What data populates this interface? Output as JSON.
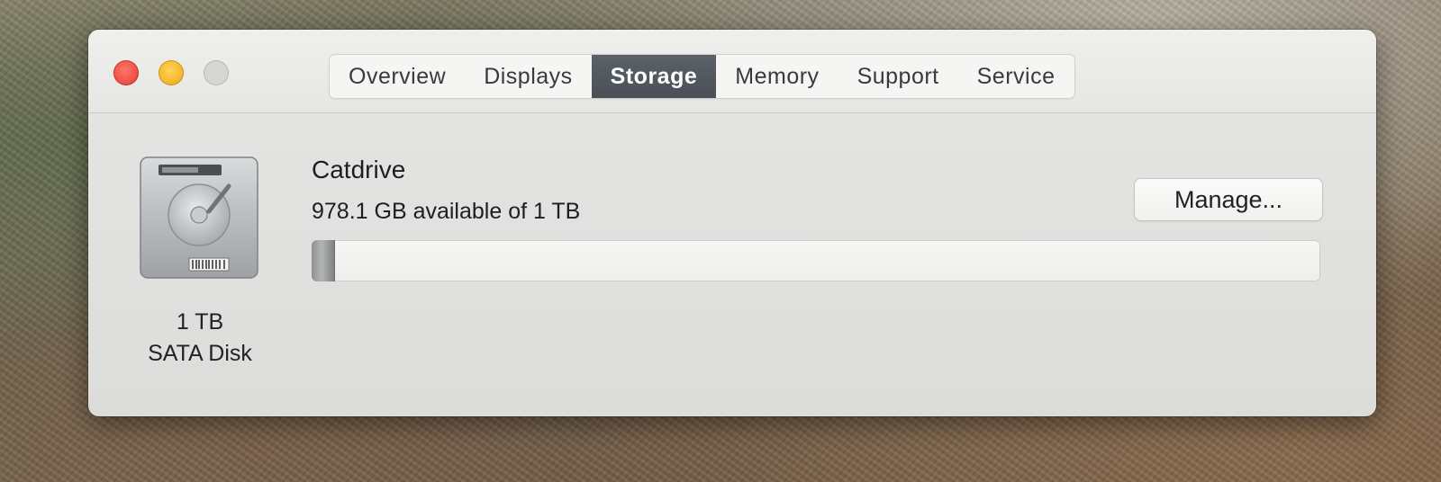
{
  "window": {
    "tabs": [
      {
        "label": "Overview",
        "active": false
      },
      {
        "label": "Displays",
        "active": false
      },
      {
        "label": "Storage",
        "active": true
      },
      {
        "label": "Memory",
        "active": false
      },
      {
        "label": "Support",
        "active": false
      },
      {
        "label": "Service",
        "active": false
      }
    ]
  },
  "storage": {
    "disk": {
      "icon": "hard-drive-icon",
      "capacity": "1 TB",
      "type": "SATA Disk"
    },
    "volume": {
      "name": "Catdrive",
      "available_text": "978.1 GB available of 1 TB",
      "used_fraction": 0.022
    },
    "manage_label": "Manage..."
  },
  "colors": {
    "close": "#ed5148",
    "minimize": "#f4b92e",
    "active_tab": "#4f555b"
  }
}
